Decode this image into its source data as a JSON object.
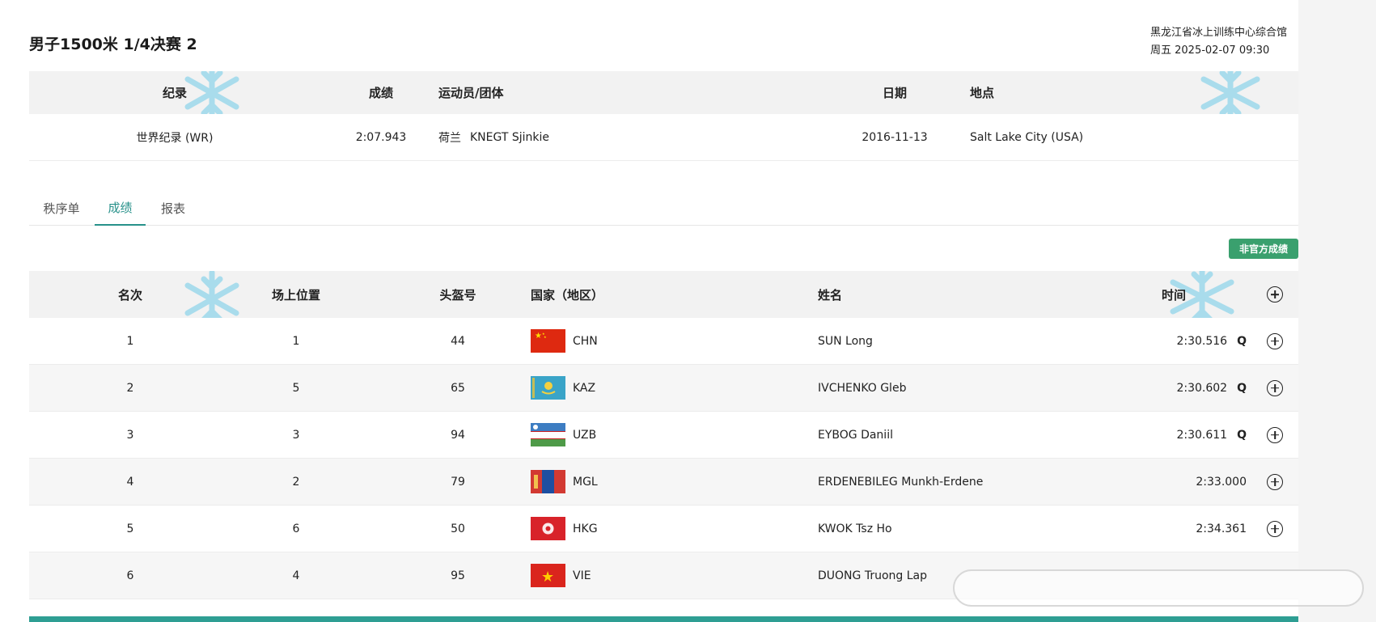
{
  "event": {
    "title": "男子1500米 1/4决赛 2",
    "venue": "黑龙江省冰上训练中心综合馆",
    "datetime": "周五 2025-02-07 09:30"
  },
  "record_table": {
    "headers": [
      "纪录",
      "成绩",
      "运动员/团体",
      "日期",
      "地点"
    ],
    "row": {
      "record": "世界纪录 (WR)",
      "result": "2:07.943",
      "country": "荷兰",
      "athlete": "KNEGT Sjinkie",
      "date": "2016-11-13",
      "location": "Salt Lake City (USA)"
    }
  },
  "tabs": [
    {
      "label": "秩序单",
      "active": false
    },
    {
      "label": "成绩",
      "active": true
    },
    {
      "label": "报表",
      "active": false
    }
  ],
  "badge": "非官方成绩",
  "results": {
    "headers": [
      "名次",
      "场上位置",
      "头盔号",
      "国家（地区）",
      "姓名",
      "时间"
    ],
    "rows": [
      {
        "rank": "1",
        "pos": "1",
        "helmet": "44",
        "noc": "CHN",
        "name": "SUN Long",
        "time": "2:30.516",
        "q": "Q",
        "flag": "chn"
      },
      {
        "rank": "2",
        "pos": "5",
        "helmet": "65",
        "noc": "KAZ",
        "name": "IVCHENKO Gleb",
        "time": "2:30.602",
        "q": "Q",
        "flag": "kaz"
      },
      {
        "rank": "3",
        "pos": "3",
        "helmet": "94",
        "noc": "UZB",
        "name": "EYBOG Daniil",
        "time": "2:30.611",
        "q": "Q",
        "flag": "uzb"
      },
      {
        "rank": "4",
        "pos": "2",
        "helmet": "79",
        "noc": "MGL",
        "name": "ERDENEBILEG Munkh-Erdene",
        "time": "2:33.000",
        "q": "",
        "flag": "mgl"
      },
      {
        "rank": "5",
        "pos": "6",
        "helmet": "50",
        "noc": "HKG",
        "name": "KWOK Tsz Ho",
        "time": "2:34.361",
        "q": "",
        "flag": "hkg"
      },
      {
        "rank": "6",
        "pos": "4",
        "helmet": "95",
        "noc": "VIE",
        "name": "DUONG Truong Lap",
        "time": "",
        "q": "",
        "flag": "vie"
      }
    ]
  },
  "colors": {
    "accent": "#27918a",
    "badge": "#3aa06e",
    "bottom_bar": "#2e9e93",
    "snowflake": "#a9dcec"
  }
}
